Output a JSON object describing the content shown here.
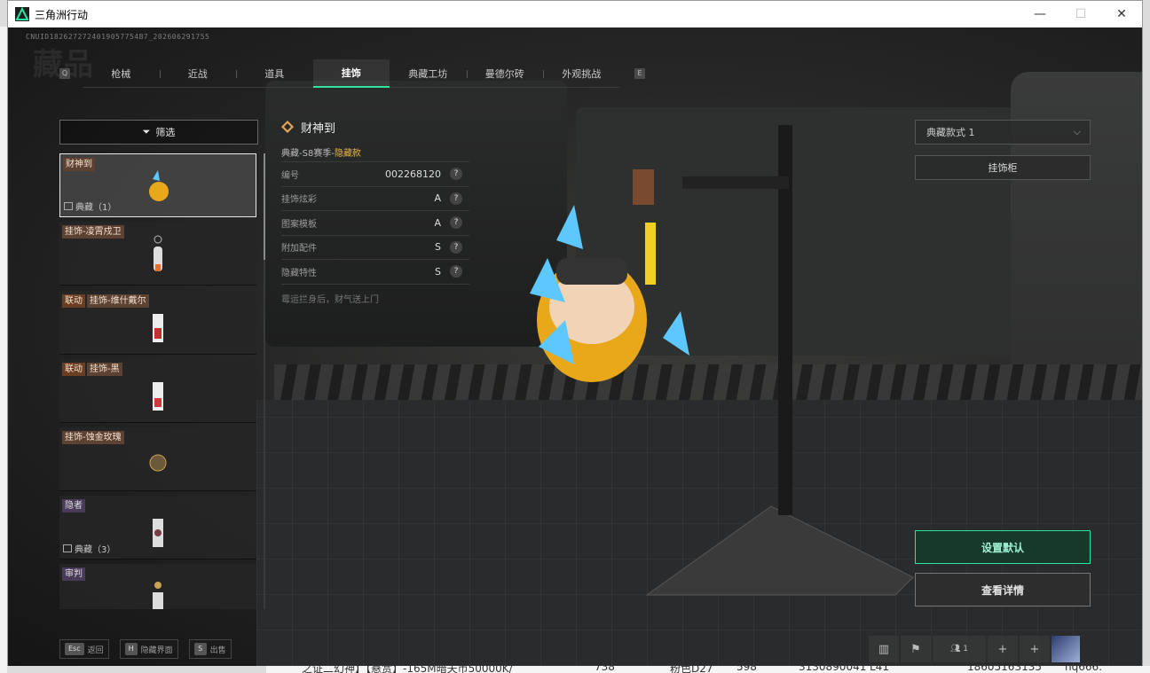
{
  "window": {
    "title": "三角洲行动",
    "minimize": "—",
    "maximize": "☐",
    "close": "✕"
  },
  "uid": "CNUID1826272724019057754B7_202606291755",
  "bg_title": "藏品",
  "tabs": [
    {
      "label": "枪械",
      "active": false
    },
    {
      "label": "近战",
      "active": false
    },
    {
      "label": "道具",
      "active": false
    },
    {
      "label": "挂饰",
      "active": true
    },
    {
      "label": "典藏工坊",
      "active": false
    },
    {
      "label": "曼德尔砖",
      "active": false
    },
    {
      "label": "外观挑战",
      "active": false
    }
  ],
  "key_q": "Q",
  "key_e": "E",
  "filter": {
    "label": "筛选",
    "icon": "filter-icon"
  },
  "items": [
    {
      "tags": [
        "财神到"
      ],
      "footer": "典藏（1）",
      "selected": true
    },
    {
      "tags": [
        "挂饰-凌霄戍卫"
      ],
      "footer": "",
      "selected": false
    },
    {
      "tags": [
        "联动",
        "挂饰-维什戴尔"
      ],
      "footer": "",
      "selected": false
    },
    {
      "tags": [
        "联动",
        "挂饰-黑"
      ],
      "footer": "",
      "selected": false
    },
    {
      "tags": [
        "挂饰-蚀金玫瑰"
      ],
      "footer": "",
      "selected": false
    },
    {
      "tags": [
        "隐者"
      ],
      "footer": "典藏（3）",
      "selected": false
    },
    {
      "tags": [
        "审判"
      ],
      "footer": "",
      "selected": false
    }
  ],
  "detail": {
    "title": "财神到",
    "subtitle_prefix": "典藏-S8赛季-",
    "subtitle_type": "隐藏款",
    "rows": [
      {
        "key": "编号",
        "value": "002268120"
      },
      {
        "key": "挂饰炫彩",
        "value": "A"
      },
      {
        "key": "图案模板",
        "value": "A"
      },
      {
        "key": "附加配件",
        "value": "S"
      },
      {
        "key": "隐藏特性",
        "value": "S"
      }
    ],
    "help": "?",
    "description": "霉运拦身后，财气送上门"
  },
  "style_select": {
    "value": "典藏款式 1",
    "chevron": "⌵"
  },
  "charm_cabinet": "挂饰柜",
  "set_default": "设置默认",
  "view_details": "查看详情",
  "footer_hints": [
    {
      "key": "Esc",
      "label": "返回"
    },
    {
      "key": "H",
      "label": "隐藏界面"
    },
    {
      "key": "S",
      "label": "出售"
    }
  ],
  "bottom_right": {
    "count": "1",
    "plus": "+"
  },
  "colors": {
    "accent": "#2fe3a0",
    "tag": "#5b4232",
    "hidden_type": "#e8b84a"
  },
  "desktop_text": [
    "之证二幻神】【悬赏】-165M暗夫币50000K/",
    "738",
    "粉色D27",
    "598",
    "3130890041",
    "L41",
    "18605163135",
    "hq666:"
  ]
}
